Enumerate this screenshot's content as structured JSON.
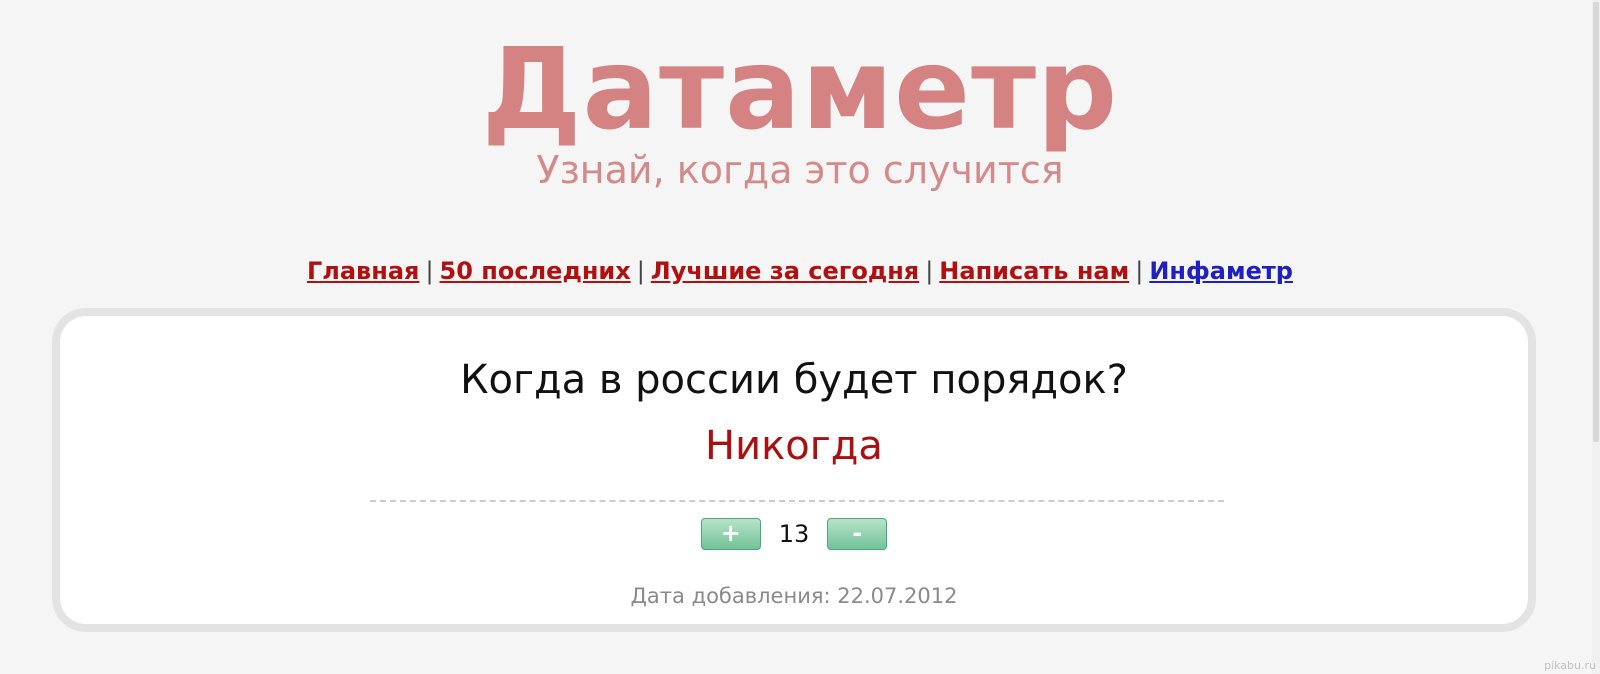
{
  "logo": {
    "title": "Датаметр",
    "tagline": "Узнай, когда это случится"
  },
  "nav": {
    "items": [
      {
        "label": "Главная"
      },
      {
        "label": "50 последних"
      },
      {
        "label": "Лучшие за сегодня"
      },
      {
        "label": "Написать нам"
      },
      {
        "label": "Инфаметр"
      }
    ],
    "separator": "|"
  },
  "card": {
    "question": "Когда в россии будет порядок?",
    "answer": "Никогда",
    "votes": {
      "plus_label": "+",
      "count": "13",
      "minus_label": "-"
    },
    "date_text": "Дата добавления: 22.07.2012"
  },
  "watermark": "pikabu.ru",
  "colors": {
    "link": "#b01010",
    "link_alt": "#2020c0",
    "answer": "#aa1010",
    "logo": "#d48282",
    "vote_button": "#72c39a"
  }
}
